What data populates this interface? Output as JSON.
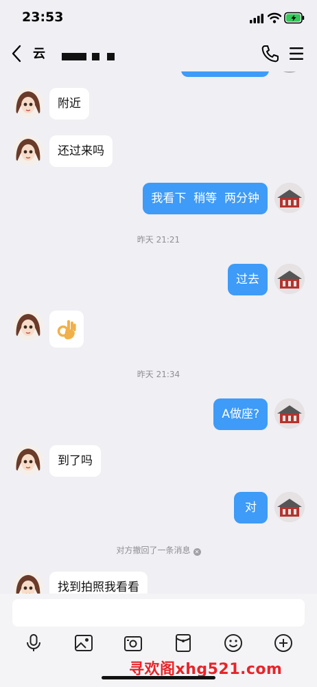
{
  "status_bar": {
    "time": "23:53"
  },
  "header": {
    "contact_name": "云"
  },
  "messages": [
    {
      "side": "left",
      "text": "附近"
    },
    {
      "side": "left",
      "text": "还过来吗"
    },
    {
      "side": "right",
      "text": "我看下  稍等  两分钟"
    },
    {
      "type": "timestamp",
      "text": "昨天 21:21"
    },
    {
      "side": "right",
      "text": "过去"
    },
    {
      "side": "left",
      "emoji": "👌"
    },
    {
      "type": "timestamp",
      "text": "昨天 21:34"
    },
    {
      "side": "right",
      "text": "A做座?"
    },
    {
      "side": "left",
      "text": "到了吗"
    },
    {
      "side": "right",
      "text": "对"
    },
    {
      "type": "recall",
      "text": "对方撤回了一条消息"
    },
    {
      "side": "left",
      "text": "找到拍照我看看"
    }
  ],
  "input": {
    "placeholder": ""
  },
  "toolbar": {
    "icons": [
      "microphone-icon",
      "image-icon",
      "camera-icon",
      "red-packet-icon",
      "emoji-icon",
      "plus-icon"
    ]
  },
  "watermark": "寻欢阁xhg521.com",
  "colors": {
    "bubble_blue": "#3e9bf7",
    "background": "#efeff4",
    "watermark_red": "#e8242a"
  }
}
